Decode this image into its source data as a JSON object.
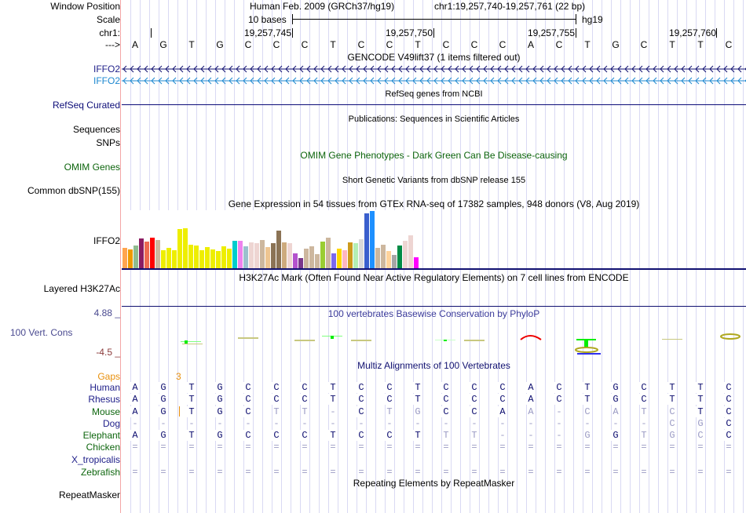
{
  "header": {
    "window_position_label": "Window Position",
    "scale_label": "Scale",
    "chr_label": "chr1:",
    "strand_label": "--->",
    "assembly": "Human Feb. 2009 (GRCh37/hg19)",
    "position": "chr1:19,257,740-19,257,761 (22 bp)",
    "scale_text": "10 bases",
    "scale_db": "hg19",
    "ticks": [
      "19,257,745",
      "19,257,750",
      "19,257,755",
      "19,257,760"
    ],
    "bases": [
      "A",
      "G",
      "T",
      "G",
      "C",
      "C",
      "C",
      "T",
      "C",
      "C",
      "T",
      "C",
      "C",
      "C",
      "A",
      "C",
      "T",
      "G",
      "C",
      "T",
      "T",
      "C"
    ]
  },
  "tracks": {
    "gencode_title": "GENCODE V49lift37 (1 items filtered out)",
    "gencode_items": [
      "IFFO2",
      "IFFO2"
    ],
    "refseq_title": "RefSeq genes from NCBI",
    "refseq_label": "RefSeq Curated",
    "publications_title": "Publications: Sequences in Scientific Articles",
    "sequences_label": "Sequences",
    "snps_label": "SNPs",
    "omim_title": "OMIM Gene Phenotypes - Dark Green Can Be Disease-causing",
    "omim_label": "OMIM Genes",
    "dbsnp_title": "Short Genetic Variants from dbSNP release 155",
    "dbsnp_label": "Common dbSNP(155)",
    "gtex_title": "Gene Expression in 54 tissues from GTEx RNA-seq of 17382 samples, 948 donors (V8, Aug 2019)",
    "gtex_label": "IFFO2",
    "h3k27ac_title": "H3K27Ac Mark (Often Found Near Active Regulatory Elements) on 7 cell lines from ENCODE",
    "h3k27ac_label": "Layered H3K27Ac",
    "cons_title": "100 vertebrates Basewise Conservation by PhyloP",
    "cons_label": "100 Vert. Cons",
    "cons_max": "4.88 _",
    "cons_min": "-4.5 _",
    "multiz_title": "Multiz Alignments of 100 Vertebrates",
    "gaps_label": "Gaps",
    "gaps_value": "3",
    "repeat_title": "Repeating Elements by RepeatMasker",
    "repeat_label": "RepeatMasker"
  },
  "gtex": {
    "bars": [
      {
        "value": 26,
        "color": "#ffa54f"
      },
      {
        "value": 24,
        "color": "#ee9a00"
      },
      {
        "value": 29,
        "color": "#8fbc8f"
      },
      {
        "value": 38,
        "color": "#8b1c62"
      },
      {
        "value": 34,
        "color": "#ee6a50"
      },
      {
        "value": 39,
        "color": "#ff0000"
      },
      {
        "value": 36,
        "color": "#cdb79e"
      },
      {
        "value": 23,
        "color": "#eeee00"
      },
      {
        "value": 26,
        "color": "#eeee00"
      },
      {
        "value": 23,
        "color": "#eeee00"
      },
      {
        "value": 50,
        "color": "#eeee00"
      },
      {
        "value": 51,
        "color": "#eeee00"
      },
      {
        "value": 30,
        "color": "#eeee00"
      },
      {
        "value": 29,
        "color": "#eeee00"
      },
      {
        "value": 23,
        "color": "#eeee00"
      },
      {
        "value": 27,
        "color": "#eeee00"
      },
      {
        "value": 24,
        "color": "#eeee00"
      },
      {
        "value": 22,
        "color": "#eeee00"
      },
      {
        "value": 28,
        "color": "#eeee00"
      },
      {
        "value": 25,
        "color": "#eeee00"
      },
      {
        "value": 35,
        "color": "#00cdcd"
      },
      {
        "value": 35,
        "color": "#ee82ee"
      },
      {
        "value": 28,
        "color": "#9ac0cd"
      },
      {
        "value": 33,
        "color": "#eed5d2"
      },
      {
        "value": 32,
        "color": "#eed5d2"
      },
      {
        "value": 36,
        "color": "#cdb79e"
      },
      {
        "value": 27,
        "color": "#eec591"
      },
      {
        "value": 32,
        "color": "#8b7355"
      },
      {
        "value": 48,
        "color": "#8b7355"
      },
      {
        "value": 33,
        "color": "#cdaa7d"
      },
      {
        "value": 32,
        "color": "#eed5d2"
      },
      {
        "value": 19,
        "color": "#b452cd"
      },
      {
        "value": 13,
        "color": "#7a378b"
      },
      {
        "value": 25,
        "color": "#cdb79e"
      },
      {
        "value": 28,
        "color": "#cdb79e"
      },
      {
        "value": 18,
        "color": "#cdb79e"
      },
      {
        "value": 34,
        "color": "#9acd32"
      },
      {
        "value": 39,
        "color": "#cdb79e"
      },
      {
        "value": 19,
        "color": "#7b68ee"
      },
      {
        "value": 25,
        "color": "#ffd700"
      },
      {
        "value": 23,
        "color": "#ffb6c1"
      },
      {
        "value": 33,
        "color": "#cd9b1d"
      },
      {
        "value": 32,
        "color": "#b4eeb4"
      },
      {
        "value": 37,
        "color": "#d9d9d9"
      },
      {
        "value": 70,
        "color": "#3a5fcd"
      },
      {
        "value": 73,
        "color": "#1e90ff"
      },
      {
        "value": 26,
        "color": "#cdb79e"
      },
      {
        "value": 30,
        "color": "#cdb79e"
      },
      {
        "value": 22,
        "color": "#ffd39b"
      },
      {
        "value": 17,
        "color": "#a6a6a6"
      },
      {
        "value": 29,
        "color": "#008b45"
      },
      {
        "value": 35,
        "color": "#eed5d2"
      },
      {
        "value": 42,
        "color": "#eed5d2"
      },
      {
        "value": 14,
        "color": "#ff00ff"
      }
    ]
  },
  "alignment": {
    "species": [
      {
        "name": "Human",
        "color": "navy",
        "seq": "AGTGCCCTCCTCCCACTGCTTC",
        "faded": ""
      },
      {
        "name": "Rhesus",
        "color": "navy",
        "seq": "AGTGCCCTCCTCCCACTGCTTC",
        "faded": ""
      },
      {
        "name": "Mouse",
        "color": "green",
        "seq": "AGTGCTT-CTGCCAA-CATCTC",
        "faded": "0000011101100010111100"
      },
      {
        "name": "Dog",
        "color": "navy",
        "seq": "-------------------CGC",
        "faded": "1111111111111111111110"
      },
      {
        "name": "Elephant",
        "color": "green",
        "seq": "AGTGCCCTCCTTT---GGTGCC",
        "faded": "0000000000011111101110"
      },
      {
        "name": "Chicken",
        "color": "green",
        "seq": "======================",
        "faded": "1111111111111111111111"
      },
      {
        "name": "X_tropicalis",
        "color": "navy",
        "seq": "",
        "faded": ""
      },
      {
        "name": "Zebrafish",
        "color": "green",
        "seq": "======================",
        "faded": "1111111111111111111111"
      }
    ]
  },
  "colors": {
    "navy": "#0b0b6e",
    "accent_line": "#000080",
    "gaps": "#e8900c"
  }
}
